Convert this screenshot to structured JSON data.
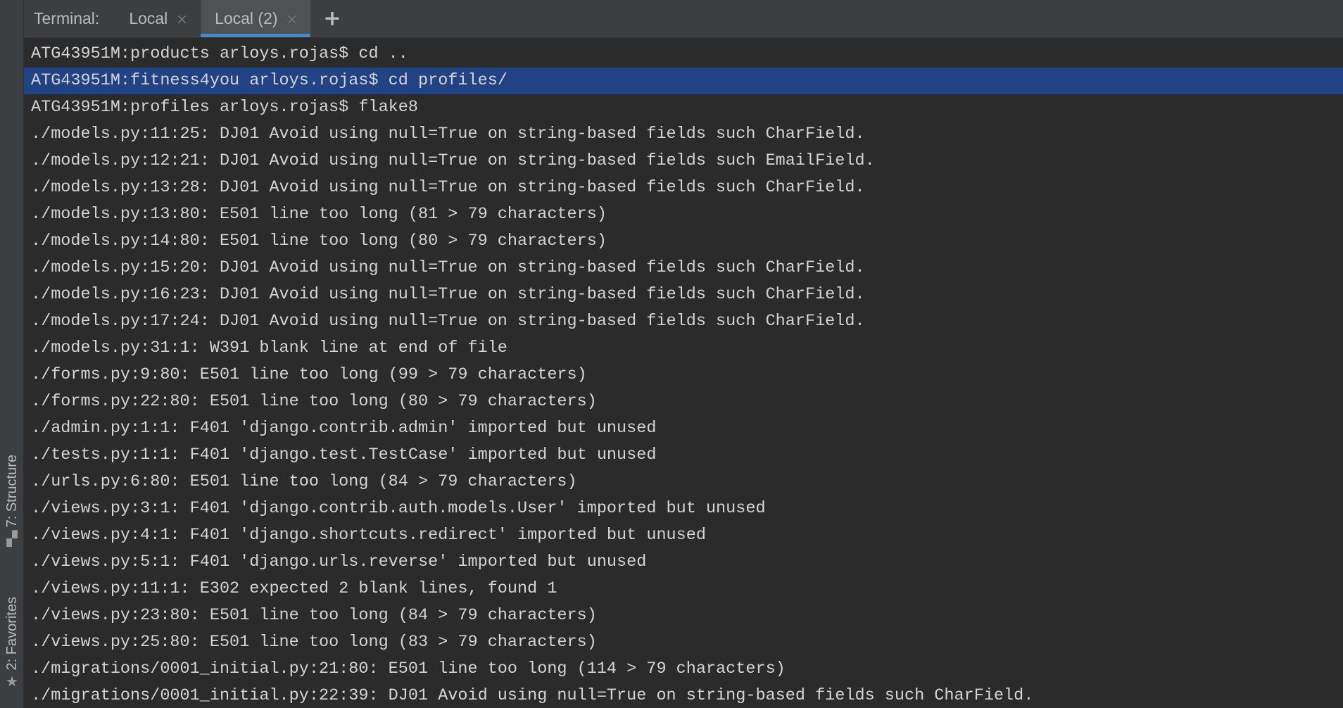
{
  "tabbar": {
    "title": "Terminal:",
    "tabs": [
      {
        "label": "Local",
        "close": "×",
        "active": false
      },
      {
        "label": "Local (2)",
        "close": "×",
        "active": true
      }
    ],
    "add_label": "+"
  },
  "side_tools": {
    "structure": {
      "label": "7: Structure",
      "icon": "structure-icon"
    },
    "favorites": {
      "label": "2: Favorites",
      "icon": "star-icon"
    }
  },
  "colors": {
    "background": "#2b2b2b",
    "toolbar": "#3c3f41",
    "active_tab_underline": "#4a88c7",
    "selection": "#214283"
  },
  "terminal": {
    "highlighted_line": 1,
    "lines": [
      "ATG43951M:products arloys.rojas$ cd ..",
      "ATG43951M:fitness4you arloys.rojas$ cd profiles/",
      "ATG43951M:profiles arloys.rojas$ flake8",
      "./models.py:11:25: DJ01 Avoid using null=True on string-based fields such CharField.",
      "./models.py:12:21: DJ01 Avoid using null=True on string-based fields such EmailField.",
      "./models.py:13:28: DJ01 Avoid using null=True on string-based fields such CharField.",
      "./models.py:13:80: E501 line too long (81 > 79 characters)",
      "./models.py:14:80: E501 line too long (80 > 79 characters)",
      "./models.py:15:20: DJ01 Avoid using null=True on string-based fields such CharField.",
      "./models.py:16:23: DJ01 Avoid using null=True on string-based fields such CharField.",
      "./models.py:17:24: DJ01 Avoid using null=True on string-based fields such CharField.",
      "./models.py:31:1: W391 blank line at end of file",
      "./forms.py:9:80: E501 line too long (99 > 79 characters)",
      "./forms.py:22:80: E501 line too long (80 > 79 characters)",
      "./admin.py:1:1: F401 'django.contrib.admin' imported but unused",
      "./tests.py:1:1: F401 'django.test.TestCase' imported but unused",
      "./urls.py:6:80: E501 line too long (84 > 79 characters)",
      "./views.py:3:1: F401 'django.contrib.auth.models.User' imported but unused",
      "./views.py:4:1: F401 'django.shortcuts.redirect' imported but unused",
      "./views.py:5:1: F401 'django.urls.reverse' imported but unused",
      "./views.py:11:1: E302 expected 2 blank lines, found 1",
      "./views.py:23:80: E501 line too long (84 > 79 characters)",
      "./views.py:25:80: E501 line too long (83 > 79 characters)",
      "./migrations/0001_initial.py:21:80: E501 line too long (114 > 79 characters)",
      "./migrations/0001_initial.py:22:39: DJ01 Avoid using null=True on string-based fields such CharField."
    ]
  }
}
